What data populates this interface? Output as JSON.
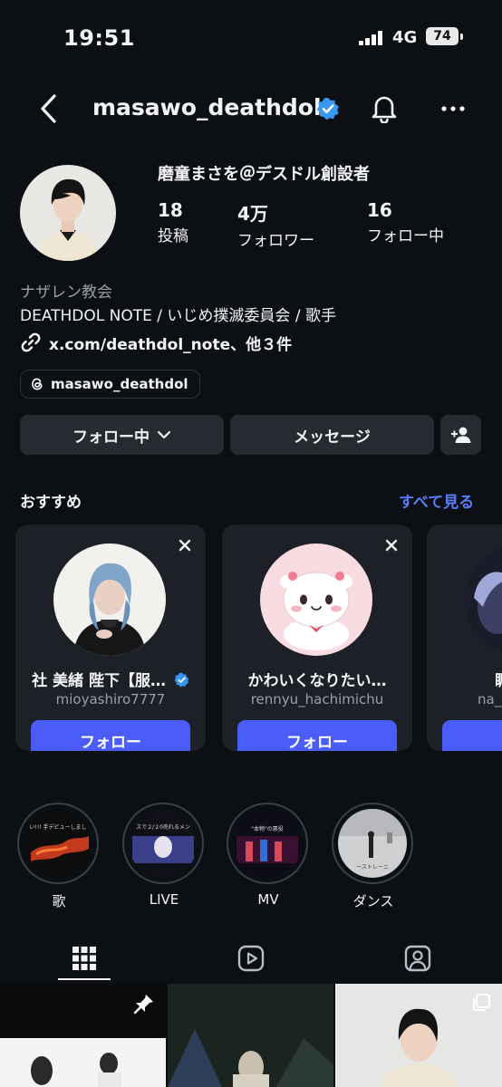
{
  "status_bar": {
    "time": "19:51",
    "network": "4G",
    "battery": "74"
  },
  "header": {
    "username": "masawo_deathdol"
  },
  "profile": {
    "display_name": "磨童まさを＠デスドル創設者",
    "stats": [
      {
        "value": "18",
        "label": "投稿"
      },
      {
        "value": "4万",
        "label": "フォロワー"
      },
      {
        "value": "16",
        "label": "フォロー中"
      }
    ],
    "category": "ナザレン教会",
    "bio": "DEATHDOL NOTE / いじめ撲滅委員会 / 歌手",
    "link": "x.com/deathdol_note、他３件",
    "threads_handle": "masawo_deathdol"
  },
  "actions": {
    "following": "フォロー中",
    "message": "メッセージ"
  },
  "suggestions": {
    "title": "おすすめ",
    "see_all": "すべて見る",
    "cards": [
      {
        "name": "社 美緒 陛下【服…",
        "handle": "mioyashiro7777",
        "button": "フォロー",
        "verified": true
      },
      {
        "name": "かわいくなりたい…",
        "handle": "rennyu_hachimichu",
        "button": "フォロー",
        "verified": false
      },
      {
        "name": "睭",
        "handle": "na_m",
        "button": "フ",
        "verified": false
      }
    ]
  },
  "highlights": [
    {
      "label": "歌",
      "thumb_text": "い!!! 手デビューしまし"
    },
    {
      "label": "LIVE",
      "thumb_text": "スで２/２0売れるメン"
    },
    {
      "label": "MV",
      "thumb_text": "\"本物\"の悪役"
    },
    {
      "label": "ダンス",
      "thumb_text": "ーストレーニ"
    }
  ],
  "colors": {
    "background": "#0c0f14",
    "accent": "#4a5df9",
    "link": "#5b7cf5",
    "verified": "#3897f0"
  },
  "icons": {
    "back": "chevron-left-icon",
    "bell": "bell-icon",
    "more": "more-horizontal-icon"
  }
}
